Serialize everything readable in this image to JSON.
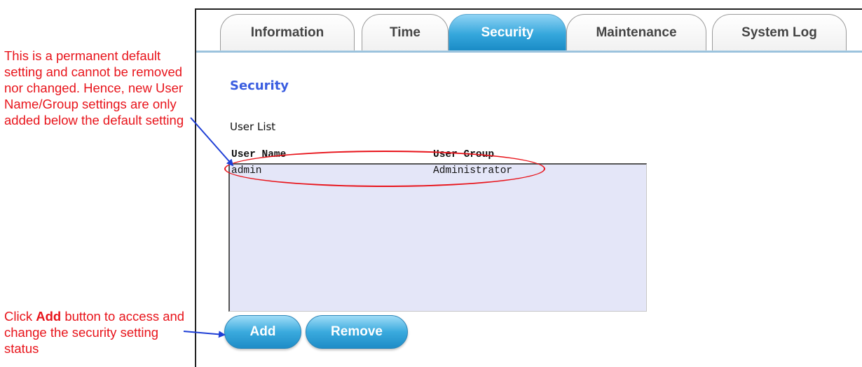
{
  "annotations": {
    "top_note": "This is a permanent default setting and cannot be removed nor changed. Hence, new User Name/Group settings are only added below the default setting",
    "bottom_note_prefix": "Click ",
    "bottom_note_bold": "Add",
    "bottom_note_suffix": " button to access and change the security setting status",
    "color": "#e8141b"
  },
  "tabs": [
    {
      "label": "Information",
      "active": false
    },
    {
      "label": "Time",
      "active": false
    },
    {
      "label": "Security",
      "active": true
    },
    {
      "label": "Maintenance",
      "active": false
    },
    {
      "label": "System Log",
      "active": false
    }
  ],
  "security": {
    "title": "Security",
    "user_list_label": "User List",
    "columns": [
      "User Name",
      "User Group"
    ],
    "rows": [
      {
        "user_name": "admin",
        "user_group": "Administrator"
      }
    ]
  },
  "buttons": {
    "add_label": "Add",
    "remove_label": "Remove"
  },
  "colors": {
    "accent": "#35a7dc",
    "title": "#3a5de0",
    "listbox_bg": "#e4e6f8",
    "arrow": "#1f3fd6"
  }
}
